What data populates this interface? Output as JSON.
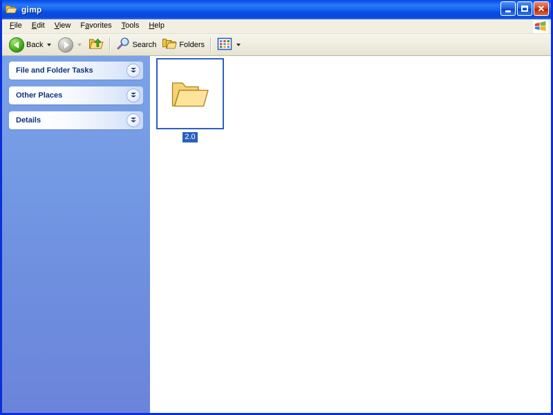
{
  "window": {
    "title": "gimp",
    "title_icon": "folder-icon",
    "controls": {
      "minimize": "Minimize",
      "maximize": "Maximize",
      "close": "Close"
    }
  },
  "menubar": {
    "items": [
      {
        "label": "File",
        "accel": "F",
        "rest": "ile"
      },
      {
        "label": "Edit",
        "accel": "E",
        "rest": "dit"
      },
      {
        "label": "View",
        "accel": "V",
        "rest": "iew"
      },
      {
        "label": "Favorites",
        "pre": "F",
        "accel": "a",
        "rest": "vorites"
      },
      {
        "label": "Tools",
        "accel": "T",
        "rest": "ools"
      },
      {
        "label": "Help",
        "accel": "H",
        "rest": "elp"
      }
    ],
    "brand_icon": "windows-logo-icon"
  },
  "toolbar": {
    "back_label": "Back",
    "back_icon": "back-arrow-icon",
    "forward_label": "",
    "forward_icon": "forward-arrow-icon",
    "forward_disabled": "true",
    "up_label": "",
    "up_icon": "up-folder-icon",
    "search_label": "Search",
    "search_icon": "magnifier-icon",
    "folders_label": "Folders",
    "folders_icon": "folders-icon",
    "views_label": "",
    "views_icon": "views-grid-icon"
  },
  "sidebar": {
    "panels": [
      {
        "title": "File and Folder Tasks",
        "state": "collapsed",
        "toggle_icon": "double-chevron-down-icon"
      },
      {
        "title": "Other Places",
        "state": "collapsed",
        "toggle_icon": "double-chevron-down-icon"
      },
      {
        "title": "Details",
        "state": "collapsed",
        "toggle_icon": "double-chevron-down-icon"
      }
    ]
  },
  "content": {
    "view_mode": "Tiles",
    "items": [
      {
        "name": "2.0",
        "type": "folder",
        "icon": "folder-icon",
        "selected": "true"
      }
    ]
  },
  "colors": {
    "titlebar_blue": "#0a4ae0",
    "selection_blue": "#2c5fbd",
    "sidebar_blue": "#7399e4",
    "panel_title": "#0c327d",
    "toolbar_bg": "#efeddf",
    "folder_yellow": "#fbd663"
  }
}
